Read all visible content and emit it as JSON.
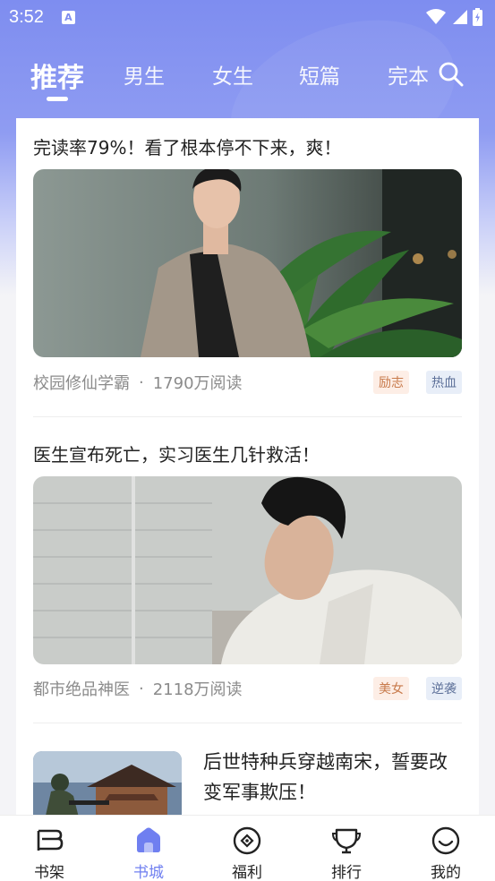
{
  "status_bar": {
    "time": "3:52",
    "icon_a": "A"
  },
  "tabs": {
    "items": [
      {
        "label": "推荐",
        "active": true
      },
      {
        "label": "男生"
      },
      {
        "label": "女生"
      },
      {
        "label": "短篇"
      },
      {
        "label": "完本"
      }
    ]
  },
  "feed": [
    {
      "title": "完读率79%！看了根本停不下来，爽！",
      "book": "校园修仙学霸",
      "reads": "1790万阅读",
      "tags": [
        "励志",
        "热血"
      ]
    },
    {
      "title": "医生宣布死亡，实习医生几针救活！",
      "book": "都市绝品神医",
      "reads": "2118万阅读",
      "tags": [
        "美女",
        "逆袭"
      ]
    },
    {
      "title": "后世特种兵穿越南宋，誓要改变军事欺压！"
    }
  ],
  "separator": "·",
  "bottom_nav": [
    {
      "label": "书架",
      "icon": "bookshelf-icon"
    },
    {
      "label": "书城",
      "icon": "home-icon",
      "active": true
    },
    {
      "label": "福利",
      "icon": "gift-icon"
    },
    {
      "label": "排行",
      "icon": "trophy-icon"
    },
    {
      "label": "我的",
      "icon": "smile-icon"
    }
  ],
  "colors": {
    "accent": "#6f7ff0",
    "header": "#7e8df0",
    "tag_orange_bg": "#fdeee6",
    "tag_blue_bg": "#e8eef8"
  }
}
